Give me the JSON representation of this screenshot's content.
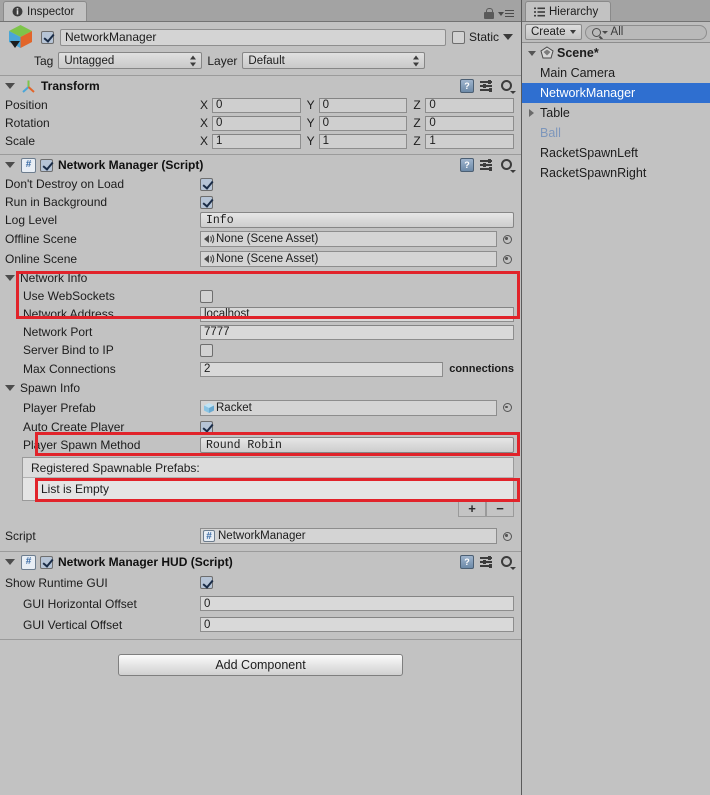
{
  "inspector": {
    "tab_label": "Inspector",
    "tab_icon": "info-icon",
    "lock_icon": "lock-icon",
    "menu_icon": "hamburger-menu-icon",
    "gameobject": {
      "icon": "prefab-cube-icon",
      "enabled": true,
      "name": "NetworkManager",
      "static_label": "Static",
      "static_checked": false,
      "tag_label": "Tag",
      "tag_value": "Untagged",
      "layer_label": "Layer",
      "layer_value": "Default"
    },
    "components": [
      {
        "title": "Transform",
        "icon": "transform-axis-icon",
        "expanded": true,
        "rows": [
          {
            "label": "Position",
            "x": "0",
            "y": "0",
            "z": "0"
          },
          {
            "label": "Rotation",
            "x": "0",
            "y": "0",
            "z": "0"
          },
          {
            "label": "Scale",
            "x": "1",
            "y": "1",
            "z": "1"
          }
        ],
        "axis_labels": {
          "x": "X",
          "y": "Y",
          "z": "Z"
        }
      },
      {
        "title": "Network Manager (Script)",
        "icon": "csharp-script-icon",
        "enabled": true,
        "expanded": true
      },
      {
        "title": "Network Manager HUD (Script)",
        "icon": "csharp-script-icon",
        "enabled": true,
        "expanded": true
      }
    ],
    "network_manager": {
      "dont_destroy_label": "Don't Destroy on Load",
      "dont_destroy_checked": true,
      "run_in_background_label": "Run in Background",
      "run_in_background_checked": true,
      "log_level_label": "Log Level",
      "log_level_value": "Info",
      "offline_scene_label": "Offline Scene",
      "offline_scene_value": "None (Scene Asset)",
      "online_scene_label": "Online Scene",
      "online_scene_value": "None (Scene Asset)",
      "network_info": {
        "section_label": "Network Info",
        "use_websockets_label": "Use WebSockets",
        "use_websockets_checked": false,
        "network_address_label": "Network Address",
        "network_address_value": "localhost",
        "network_port_label": "Network Port",
        "network_port_value": "7777",
        "server_bind_label": "Server Bind to IP",
        "server_bind_checked": false,
        "max_connections_label": "Max Connections",
        "max_connections_value": "2",
        "max_connections_suffix": "connections"
      },
      "spawn_info": {
        "section_label": "Spawn Info",
        "player_prefab_label": "Player Prefab",
        "player_prefab_value": "Racket",
        "auto_create_label": "Auto Create Player",
        "auto_create_checked": true,
        "spawn_method_label": "Player Spawn Method",
        "spawn_method_value": "Round Robin",
        "list_header": "Registered Spawnable Prefabs:",
        "list_empty_text": "List is Empty",
        "add_btn": "+",
        "remove_btn": "−"
      },
      "script_label": "Script",
      "script_value": "NetworkManager"
    },
    "network_manager_hud": {
      "show_gui_label": "Show Runtime GUI",
      "show_gui_checked": true,
      "h_offset_label": "GUI Horizontal Offset",
      "h_offset_value": "0",
      "v_offset_label": "GUI Vertical Offset",
      "v_offset_value": "0"
    },
    "add_component_label": "Add Component",
    "highlight_color": "#e1232a"
  },
  "hierarchy": {
    "tab_label": "Hierarchy",
    "tab_icon": "list-icon",
    "create_label": "Create",
    "search_placeholder": "All",
    "items": [
      {
        "label": "Scene*",
        "depth": 0,
        "arrow": "down",
        "icon": "unity-scene-icon",
        "selected": false,
        "dim": false
      },
      {
        "label": "Main Camera",
        "depth": 1,
        "arrow": "none",
        "icon": "",
        "selected": false,
        "dim": false
      },
      {
        "label": "NetworkManager",
        "depth": 1,
        "arrow": "none",
        "icon": "",
        "selected": true,
        "dim": false
      },
      {
        "label": "Table",
        "depth": 1,
        "arrow": "right",
        "icon": "",
        "selected": false,
        "dim": false
      },
      {
        "label": "Ball",
        "depth": 1,
        "arrow": "none",
        "icon": "",
        "selected": false,
        "dim": true
      },
      {
        "label": "RacketSpawnLeft",
        "depth": 1,
        "arrow": "none",
        "icon": "",
        "selected": false,
        "dim": false
      },
      {
        "label": "RacketSpawnRight",
        "depth": 1,
        "arrow": "none",
        "icon": "",
        "selected": false,
        "dim": false
      }
    ]
  }
}
